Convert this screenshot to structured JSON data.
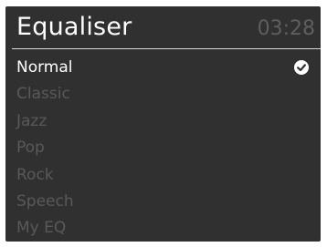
{
  "header": {
    "title": "Equaliser",
    "time": "03:28"
  },
  "menu": {
    "items": [
      {
        "label": "Normal",
        "selected": true
      },
      {
        "label": "Classic",
        "selected": false
      },
      {
        "label": "Jazz",
        "selected": false
      },
      {
        "label": "Pop",
        "selected": false
      },
      {
        "label": "Rock",
        "selected": false
      },
      {
        "label": "Speech",
        "selected": false
      },
      {
        "label": "My EQ",
        "selected": false
      }
    ]
  },
  "icons": {
    "selected_marker": "checkmark-circle-icon"
  },
  "colors": {
    "background": "#303030",
    "text_active": "#ffffff",
    "text_inactive": "#595959",
    "clock_text": "#5e5e5e",
    "divider": "#d9d9d9"
  }
}
